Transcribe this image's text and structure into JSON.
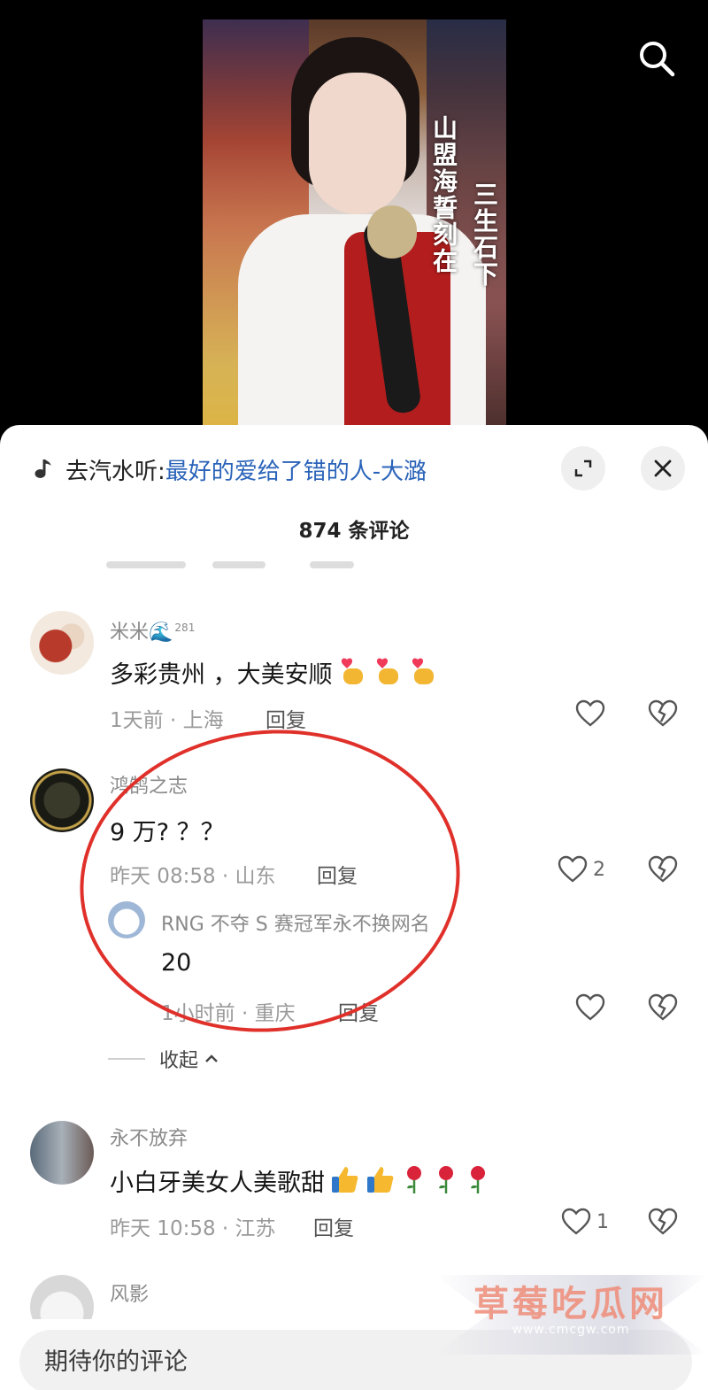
{
  "video": {
    "overlay_text_1": "山盟海誓刻在",
    "overlay_text_2": "三生石下"
  },
  "music": {
    "prefix": "去汽水听:",
    "song": "最好的爱给了错的人-大潞"
  },
  "comment_count": "874 条评论",
  "comments": [
    {
      "username": "米米",
      "badge": "281",
      "text": "多彩贵州 ，大美安顺",
      "time_location": "1天前 · 上海",
      "reply_label": "回复",
      "likes": ""
    },
    {
      "username": "鸿鹄之志",
      "text": "9 万? ？？",
      "time_location": "昨天 08:58 · 山东",
      "reply_label": "回复",
      "likes": "2",
      "sub_reply": {
        "username": "RNG 不夺 S 赛冠军永不换网名",
        "text": "20",
        "time_location": "1小时前 · 重庆",
        "reply_label": "回复",
        "likes": ""
      }
    },
    {
      "username": "永不放弃",
      "text": "小白牙美女人美歌甜",
      "time_location": "昨天 10:58 · 江苏",
      "reply_label": "回复",
      "likes": "1"
    },
    {
      "username": "风影"
    }
  ],
  "collapse_label": "收起",
  "input": {
    "placeholder": "期待你的评论"
  },
  "watermark": {
    "title": "草莓吃瓜网",
    "url": "www.cmcgw.com"
  },
  "colors": {
    "song_link": "#2a63b9",
    "annotation": "#e0302a"
  }
}
